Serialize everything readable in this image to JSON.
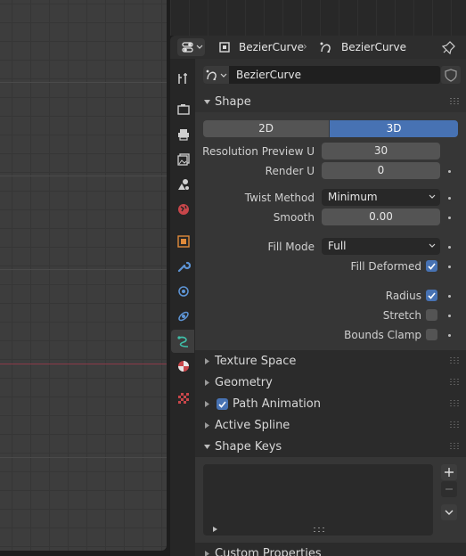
{
  "header": {
    "object_name": "BezierCurve",
    "data_name": "BezierCurve"
  },
  "datablock": {
    "name": "BezierCurve"
  },
  "shape": {
    "title": "Shape",
    "dims": [
      "2D",
      "3D"
    ],
    "active_dim": "3D",
    "resolution_preview_label": "Resolution Preview U",
    "resolution_preview_value": "30",
    "render_label": "Render U",
    "render_value": "0",
    "twist_label": "Twist Method",
    "twist_value": "Minimum",
    "smooth_label": "Smooth",
    "smooth_value": "0.00",
    "fill_mode_label": "Fill Mode",
    "fill_mode_value": "Full",
    "fill_deformed_label": "Fill Deformed",
    "fill_deformed": true,
    "radius_label": "Radius",
    "radius": true,
    "stretch_label": "Stretch",
    "stretch": false,
    "bounds_clamp_label": "Bounds Clamp",
    "bounds_clamp": false
  },
  "panels": {
    "texture_space": "Texture Space",
    "geometry": "Geometry",
    "path_animation": "Path Animation",
    "path_animation_enabled": true,
    "active_spline": "Active Spline",
    "shape_keys": "Shape Keys",
    "custom_properties": "Custom Properties"
  },
  "tabs": [
    "tool-tab",
    "render-tab",
    "output-tab",
    "view-layer-tab",
    "scene-tab",
    "world-tab",
    "object-tab",
    "modifiers-tab",
    "particles-tab",
    "physics-tab",
    "curve-data-tab",
    "material-tab",
    "texture-tab"
  ],
  "colors": {
    "accent": "#4772b3",
    "x_axis": "#8b3a48",
    "curve_tab_icon": "#3fbfa9",
    "object_tab_icon": "#e08a3a"
  }
}
